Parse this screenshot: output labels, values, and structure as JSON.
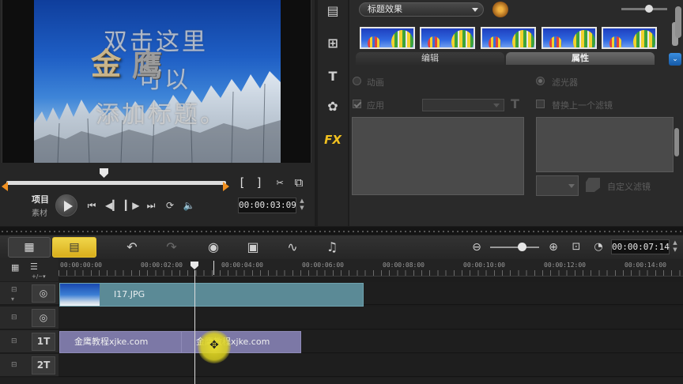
{
  "preview": {
    "overlay_lines": [
      "双击这里",
      "可以",
      "添加标题。"
    ],
    "logo_part1": "金",
    "logo_part2": "鹰",
    "mode_project": "项目",
    "mode_clip": "素材",
    "timecode": "00:00:03:09",
    "mark_in": "[",
    "mark_out": "]"
  },
  "options": {
    "category": "标题效果",
    "tab_edit": "编辑",
    "tab_attributes": "属性",
    "radio_animation": "动画",
    "radio_filter": "滤光器",
    "check_apply": "应用",
    "check_replace": "替换上一个滤镜",
    "custom_filter": "自定义滤镜",
    "side_icons": [
      "media-icon",
      "instant-project-icon",
      "title-icon",
      "graphic-icon",
      "fx-icon"
    ],
    "fx_label": "FX"
  },
  "toolbar": {
    "timecode": "00:00:07:14"
  },
  "timeline": {
    "ruler_labels": [
      "00:00:00:00",
      "00:00:02:00",
      "00:00:04:00",
      "00:00:06:00",
      "00:00:08:00",
      "00:00:10:00",
      "00:00:12:00",
      "00:00:14:00"
    ],
    "tracks": [
      {
        "label": "",
        "icon": "video-track-icon"
      },
      {
        "label": "",
        "icon": "overlay-track-icon"
      },
      {
        "label": "1T",
        "icon": "title-track-icon"
      },
      {
        "label": "2T",
        "icon": "title-track-icon"
      }
    ],
    "video_clip": "I17.JPG",
    "title_clip_1": "金鹰教程xjke.com",
    "title_clip_2": "金鹰教程xjke.com"
  },
  "colors": {
    "accent": "#f0c020",
    "video_clip": "#5b8a96",
    "title_clip": "#7c78a6",
    "trim_marker": "#f09020"
  }
}
